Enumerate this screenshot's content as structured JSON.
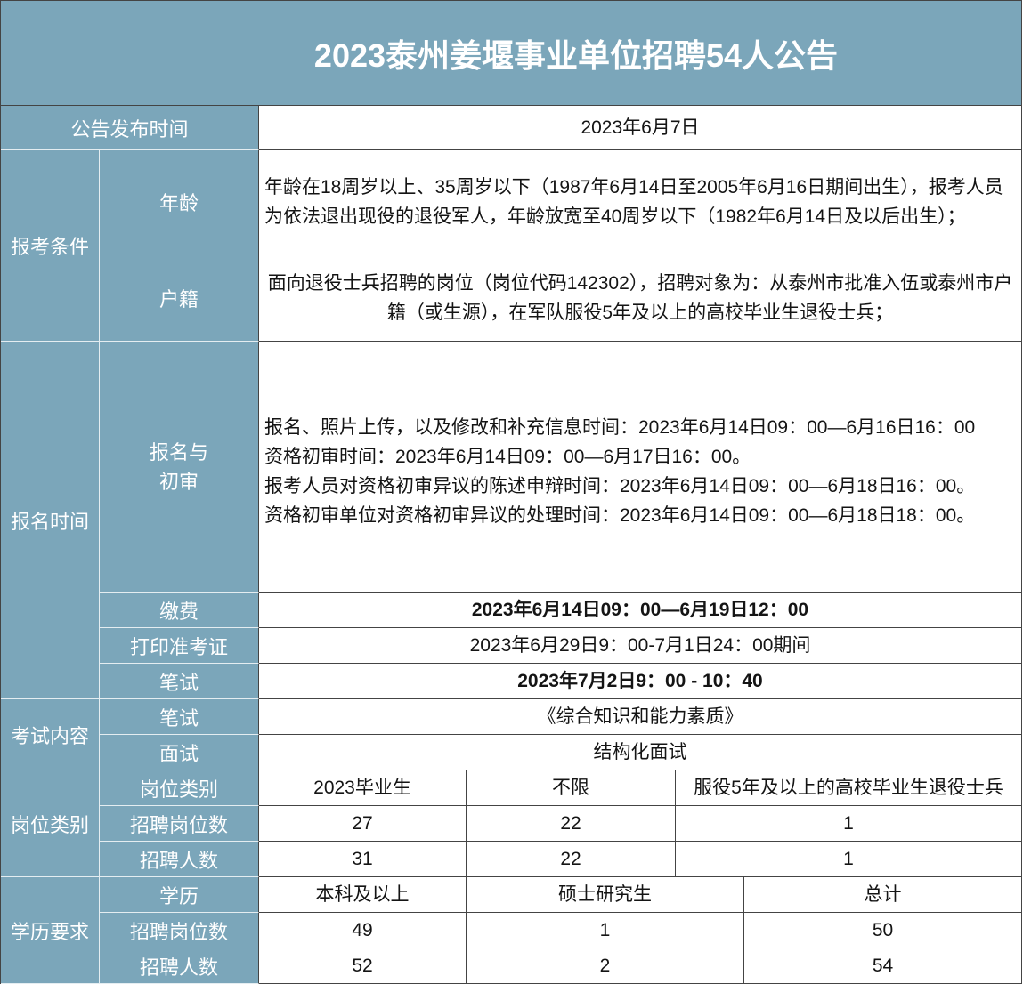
{
  "title": "2023泰州姜堰事业单位招聘54人公告",
  "colors": {
    "header_bg": "#7ba6ba",
    "label_text": "#ffffff",
    "body_text": "#141414"
  },
  "publish": {
    "label": "公告发布时间",
    "value": "2023年6月7日"
  },
  "conditions": {
    "label": "报考条件",
    "age": {
      "label": "年龄",
      "value": "年龄在18周岁以上、35周岁以下（1987年6月14日至2005年6月16日期间出生），报考人员为依法退出现役的退役军人，年龄放宽至40周岁以下（1982年6月14日及以后出生）；"
    },
    "hukou": {
      "label": "户籍",
      "value": "面向退役士兵招聘的岗位（岗位代码142302），招聘对象为：从泰州市批准入伍或泰州市户籍（或生源），在军队服役5年及以上的高校毕业生退役士兵；"
    }
  },
  "schedule": {
    "label": "报名时间",
    "registration": {
      "label": "报名与\n初审",
      "lines": [
        "报名、照片上传，以及修改和补充信息时间：2023年6月14日09：00—6月16日16：00",
        "资格初审时间：2023年6月14日09：00—6月17日16：00。",
        "报考人员对资格初审异议的陈述申辩时间：2023年6月14日09：00—6月18日16：00。",
        "资格初审单位对资格初审异议的处理时间：2023年6月14日09：00—6月18日18：00。"
      ]
    },
    "payment": {
      "label": "缴费",
      "value": "2023年6月14日09：00—6月19日12：00"
    },
    "admission": {
      "label": "打印准考证",
      "value": "2023年6月29日9：00-7月1日24：00期间"
    },
    "written": {
      "label": "笔试",
      "value": "2023年7月2日9：00 - 10：40"
    }
  },
  "exam": {
    "label": "考试内容",
    "written": {
      "label": "笔试",
      "value": "《综合知识和能力素质》"
    },
    "interview": {
      "label": "面试",
      "value": "结构化面试"
    }
  },
  "positions": {
    "label": "岗位类别",
    "rows": [
      {
        "label": "岗位类别",
        "cells": [
          "2023毕业生",
          "不限",
          "服役5年及以上的高校毕业生退役士兵"
        ]
      },
      {
        "label": "招聘岗位数",
        "cells": [
          "27",
          "22",
          "1"
        ]
      },
      {
        "label": "招聘人数",
        "cells": [
          "31",
          "22",
          "1"
        ]
      }
    ]
  },
  "education": {
    "label": "学历要求",
    "rows": [
      {
        "label": "学历",
        "cells": [
          "本科及以上",
          "硕士研究生",
          "总计"
        ]
      },
      {
        "label": "招聘岗位数",
        "cells": [
          "49",
          "1",
          "50"
        ]
      },
      {
        "label": "招聘人数",
        "cells": [
          "52",
          "2",
          "54"
        ]
      }
    ]
  }
}
